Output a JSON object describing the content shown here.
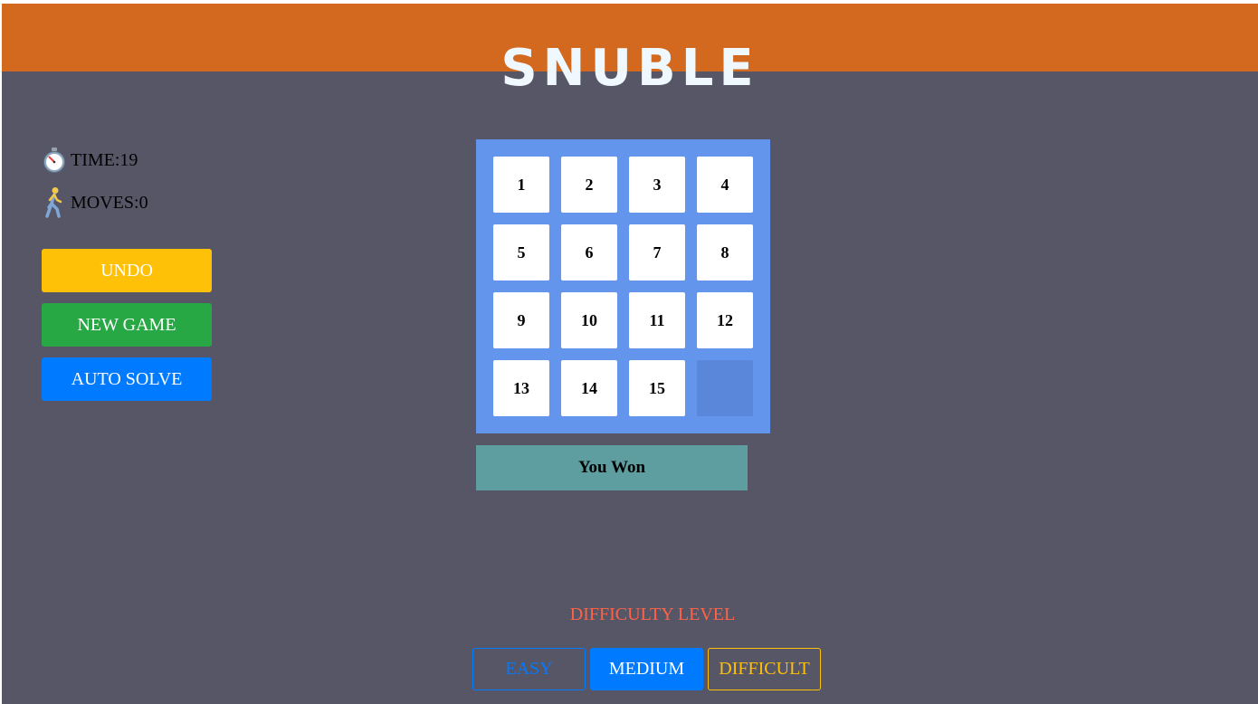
{
  "header": {
    "title": "SNUBLE"
  },
  "stats": {
    "time_label": "TIME:19",
    "moves_label": "MOVES:0",
    "time_icon": "stopwatch-icon",
    "moves_icon": "walking-person-icon"
  },
  "actions": {
    "undo": "UNDO",
    "new_game": "NEW GAME",
    "auto_solve": "AUTO SOLVE"
  },
  "board": {
    "rows": 4,
    "cols": 4,
    "tiles": [
      "1",
      "2",
      "3",
      "4",
      "5",
      "6",
      "7",
      "8",
      "9",
      "10",
      "11",
      "12",
      "13",
      "14",
      "15",
      ""
    ]
  },
  "status": {
    "message": "You Won"
  },
  "difficulty": {
    "label": "DIFFICULTY LEVEL",
    "easy": "EASY",
    "medium": "MEDIUM",
    "difficult": "DIFFICULT",
    "selected": "MEDIUM"
  },
  "colors": {
    "header": "#d2691e",
    "background": "#575666",
    "board": "#6495ed",
    "banner": "#5f9ea0",
    "undo": "#ffc107",
    "new_game": "#28a745",
    "auto_solve": "#007bff",
    "difficulty_label": "#ff6347"
  }
}
